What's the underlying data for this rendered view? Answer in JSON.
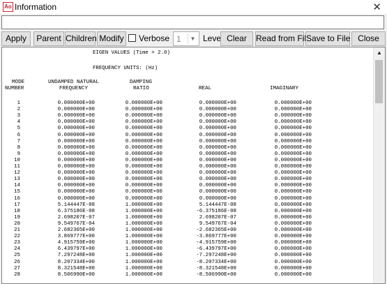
{
  "window": {
    "title": "Information",
    "icon_text": "Ao",
    "close_glyph": "✕"
  },
  "command_input": {
    "value": ""
  },
  "toolbar": {
    "apply": "Apply",
    "parent": "Parent",
    "children": "Children",
    "modify": "Modify",
    "verbose": "Verbose",
    "levels_value": "1",
    "levels_label": "Levels",
    "clear": "Clear",
    "read_from_file": "Read from File",
    "save_to_file": "Save to File",
    "close": "Close"
  },
  "report": {
    "title": "EIGEN VALUES (Time = 2.0)",
    "units": "FREQUENCY UNITS: (Hz)",
    "headers": {
      "mode": "MODE",
      "number": "NUMBER",
      "undamped": "UNDAMPED NATURAL",
      "frequency": "FREQUENCY",
      "damping": "DAMPING",
      "ratio": "RATIO",
      "real": "REAL",
      "imaginary": "IMAGINARY"
    },
    "rows": [
      [
        "1",
        "0.000000E+00",
        "0.000000E+00",
        "0.000000E+00",
        "0.000000E+00"
      ],
      [
        "2",
        "0.000000E+00",
        "0.000000E+00",
        "0.000000E+00",
        "0.000000E+00"
      ],
      [
        "3",
        "0.000000E+00",
        "0.000000E+00",
        "0.000000E+00",
        "0.000000E+00"
      ],
      [
        "4",
        "0.000000E+00",
        "0.000000E+00",
        "0.000000E+00",
        "0.000000E+00"
      ],
      [
        "5",
        "0.000000E+00",
        "0.000000E+00",
        "0.000000E+00",
        "0.000000E+00"
      ],
      [
        "6",
        "0.000000E+00",
        "0.000000E+00",
        "0.000000E+00",
        "0.000000E+00"
      ],
      [
        "7",
        "0.000000E+00",
        "0.000000E+00",
        "0.000000E+00",
        "0.000000E+00"
      ],
      [
        "8",
        "0.000000E+00",
        "0.000000E+00",
        "0.000000E+00",
        "0.000000E+00"
      ],
      [
        "9",
        "0.000000E+00",
        "0.000000E+00",
        "0.000000E+00",
        "0.000000E+00"
      ],
      [
        "10",
        "0.000000E+00",
        "0.000000E+00",
        "0.000000E+00",
        "0.000000E+00"
      ],
      [
        "11",
        "0.000000E+00",
        "0.000000E+00",
        "0.000000E+00",
        "0.000000E+00"
      ],
      [
        "12",
        "0.000000E+00",
        "0.000000E+00",
        "0.000000E+00",
        "0.000000E+00"
      ],
      [
        "13",
        "0.000000E+00",
        "0.000000E+00",
        "0.000000E+00",
        "0.000000E+00"
      ],
      [
        "14",
        "0.000000E+00",
        "0.000000E+00",
        "0.000000E+00",
        "0.000000E+00"
      ],
      [
        "15",
        "0.000000E+00",
        "0.000000E+00",
        "0.000000E+00",
        "0.000000E+00"
      ],
      [
        "16",
        "0.000000E+00",
        "0.000000E+00",
        "0.000000E+00",
        "0.000000E+00"
      ],
      [
        "17",
        "5.144447E-08",
        "1.000000E+00",
        "5.144447E-08",
        "0.000000E+00"
      ],
      [
        "18",
        "6.375186E-08",
        "1.000000E+00",
        "-6.375186E-08",
        "0.000000E+00"
      ],
      [
        "19",
        "2.698207E-07",
        "1.000000E+00",
        "2.698207E-07",
        "0.000000E+00"
      ],
      [
        "20",
        "9.549767E-04",
        "1.000000E+00",
        "9.549767E-04",
        "0.000000E+00"
      ],
      [
        "21",
        "2.682365E+00",
        "1.000000E+00",
        "-2.682365E+00",
        "0.000000E+00"
      ],
      [
        "22",
        "3.869777E+00",
        "1.000000E+00",
        "-3.869777E+00",
        "0.000000E+00"
      ],
      [
        "23",
        "4.915759E+00",
        "1.000000E+00",
        "-4.915759E+00",
        "0.000000E+00"
      ],
      [
        "24",
        "6.439797E+00",
        "1.000000E+00",
        "-6.439797E+00",
        "0.000000E+00"
      ],
      [
        "25",
        "7.297248E+00",
        "1.000000E+00",
        "-7.297248E+00",
        "0.000000E+00"
      ],
      [
        "26",
        "8.207334E+00",
        "1.000000E+00",
        "-8.207334E+00",
        "0.000000E+00"
      ],
      [
        "27",
        "8.321548E+00",
        "1.000000E+00",
        "-8.321548E+00",
        "0.000000E+00"
      ],
      [
        "28",
        "8.506990E+00",
        "1.000000E+00",
        "-8.506990E+00",
        "0.000000E+00"
      ]
    ]
  },
  "icons": {
    "app": "app-icon",
    "close": "close-icon",
    "scroll_up": "scroll-up-arrow-icon",
    "dropdown": "chevron-down-icon"
  },
  "colors": {
    "accent": "#c6262e",
    "toolbar_bg": "#e1e1e1",
    "window_bg": "#f0f0f0"
  }
}
